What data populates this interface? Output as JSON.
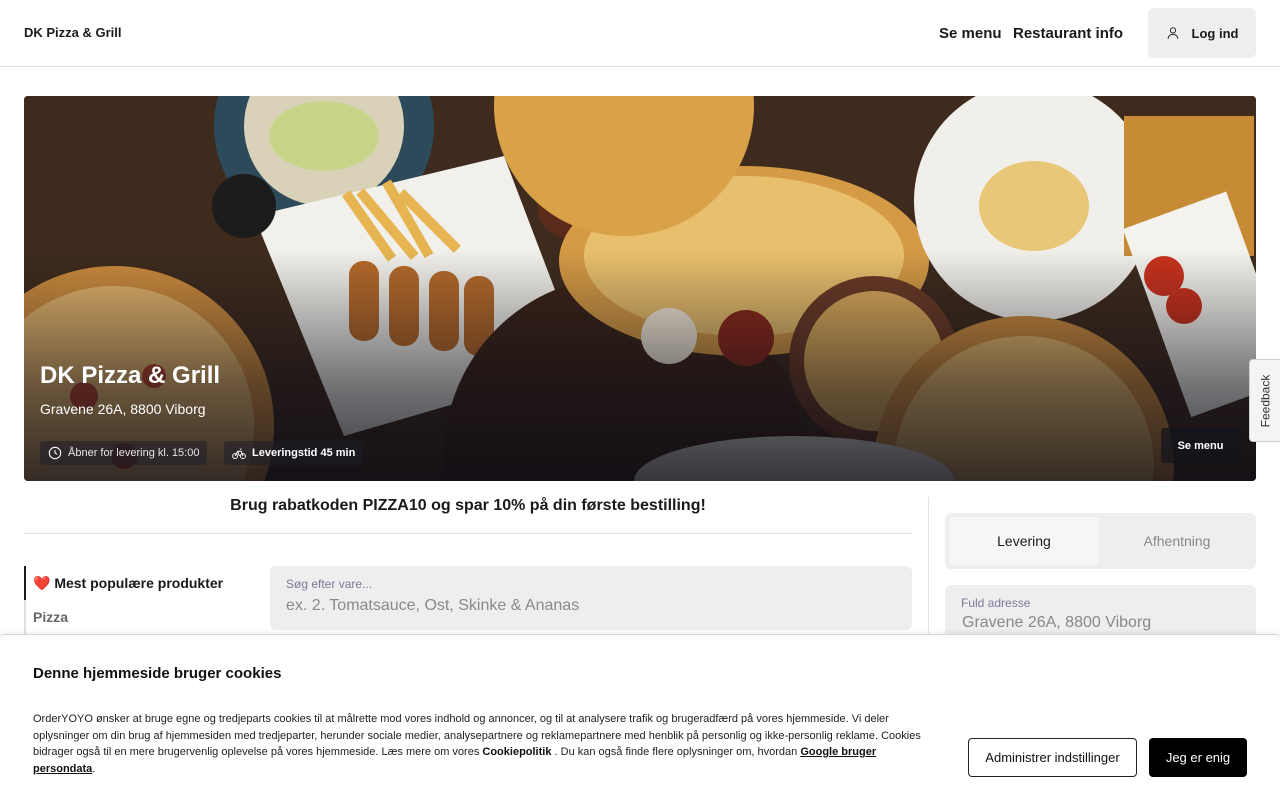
{
  "header": {
    "brand": "DK Pizza & Grill",
    "nav": {
      "menu": "Se menu",
      "info": "Restaurant info"
    },
    "login_label": "Log ind",
    "login_icon": "user-icon"
  },
  "hero": {
    "title": "DK Pizza & Grill",
    "address": "Gravene 26A, 8800 Viborg",
    "open_status": "Åbner for levering kl. 15:00",
    "open_icon": "clock-icon",
    "delivery_time": "Leveringstid 45 min",
    "delivery_icon": "bicycle-icon",
    "menu_button": "Se menu"
  },
  "feedback_label": "Feedback",
  "promo": "Brug rabatkoden PIZZA10 og spar 10% på din første bestilling!",
  "categories": {
    "active": "❤️ Mest populære produkter",
    "items": [
      "Pizza"
    ]
  },
  "search": {
    "label": "Søg efter vare...",
    "placeholder": "ex. 2. Tomatsauce, Ost, Skinke & Ananas"
  },
  "order_type": {
    "delivery": "Levering",
    "pickup": "Afhentning",
    "selected": "Levering"
  },
  "address_field": {
    "label": "Fuld adresse",
    "value": "Gravene 26A, 8800 Viborg"
  },
  "cookie": {
    "title": "Denne hjemmeside bruger cookies",
    "text_part1": "OrderYOYO ønsker at bruge egne og tredjeparts cookies til at målrette mod vores indhold og annoncer, og til at analysere trafik og brugeradfærd på vores hjemmeside. Vi deler oplysninger om din brug af hjemmesiden med tredjeparter, herunder sociale medier, analysepartnere og reklamepartnere med henblik på personlig og ikke-personlig reklame. Cookies bidrager også til en mere brugervenlig oplevelse på vores hjemmeside. Læs mere om vores ",
    "link_cookiepolicy": "Cookiepolitik",
    "text_part2": " . Du kan også finde flere oplysninger om, hvordan ",
    "link_google": "Google bruger persondata",
    "text_part3": ".",
    "btn_settings": "Administrer indstillinger",
    "btn_agree": "Jeg er enig"
  }
}
